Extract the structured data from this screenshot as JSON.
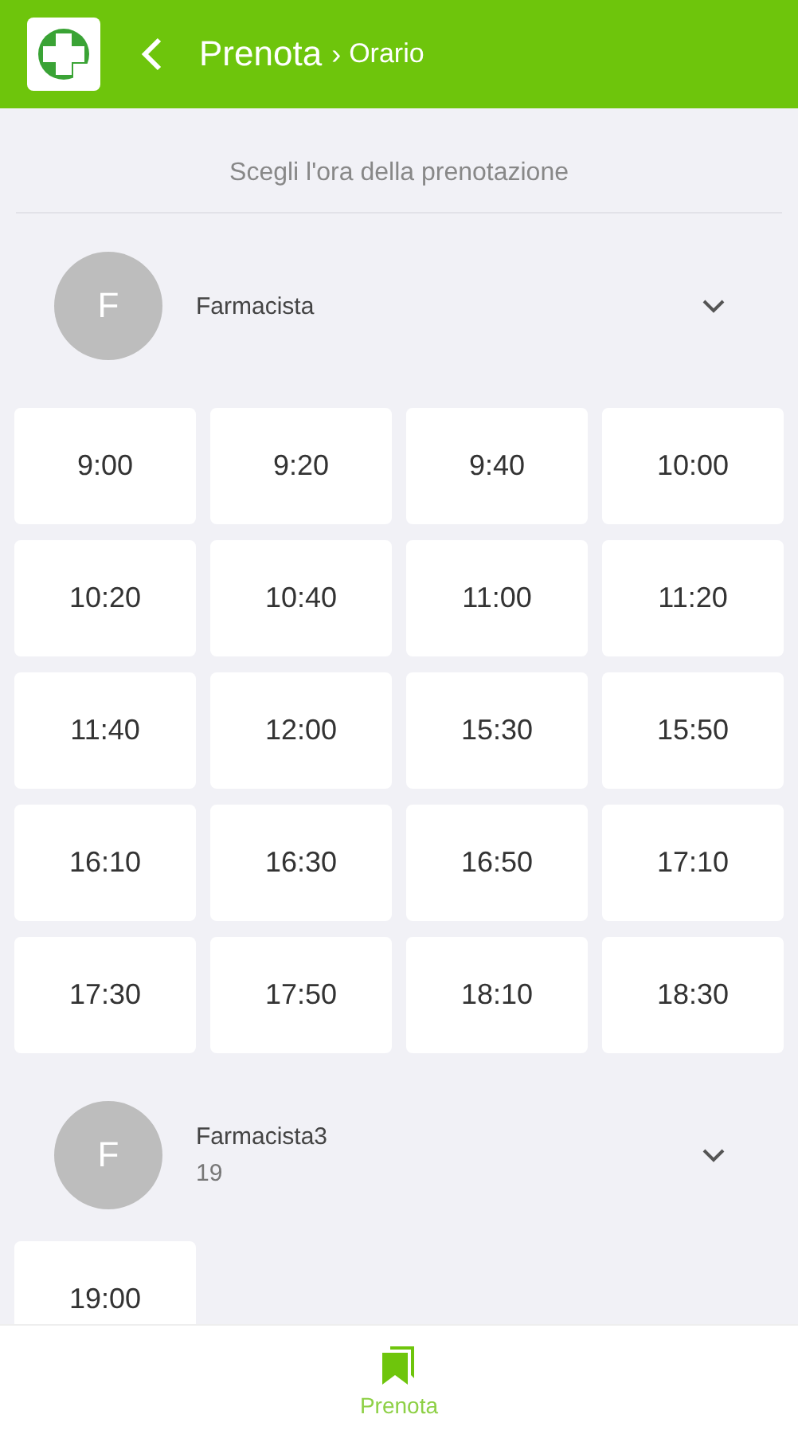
{
  "header": {
    "title": "Prenota",
    "separator": "›",
    "subtitle": "Orario"
  },
  "prompt": "Scegli l'ora della prenotazione",
  "groups": [
    {
      "initial": "F",
      "name": "Farmacista",
      "slots": [
        "9:00",
        "9:20",
        "9:40",
        "10:00",
        "10:20",
        "10:40",
        "11:00",
        "11:20",
        "11:40",
        "12:00",
        "15:30",
        "15:50",
        "16:10",
        "16:30",
        "16:50",
        "17:10",
        "17:30",
        "17:50",
        "18:10",
        "18:30"
      ]
    },
    {
      "initial": "F",
      "name": "Farmacista3",
      "detail": "19",
      "slots": [
        "19:00"
      ]
    }
  ],
  "bottom_nav": [
    {
      "label": "Prenota",
      "selected": true
    }
  ]
}
